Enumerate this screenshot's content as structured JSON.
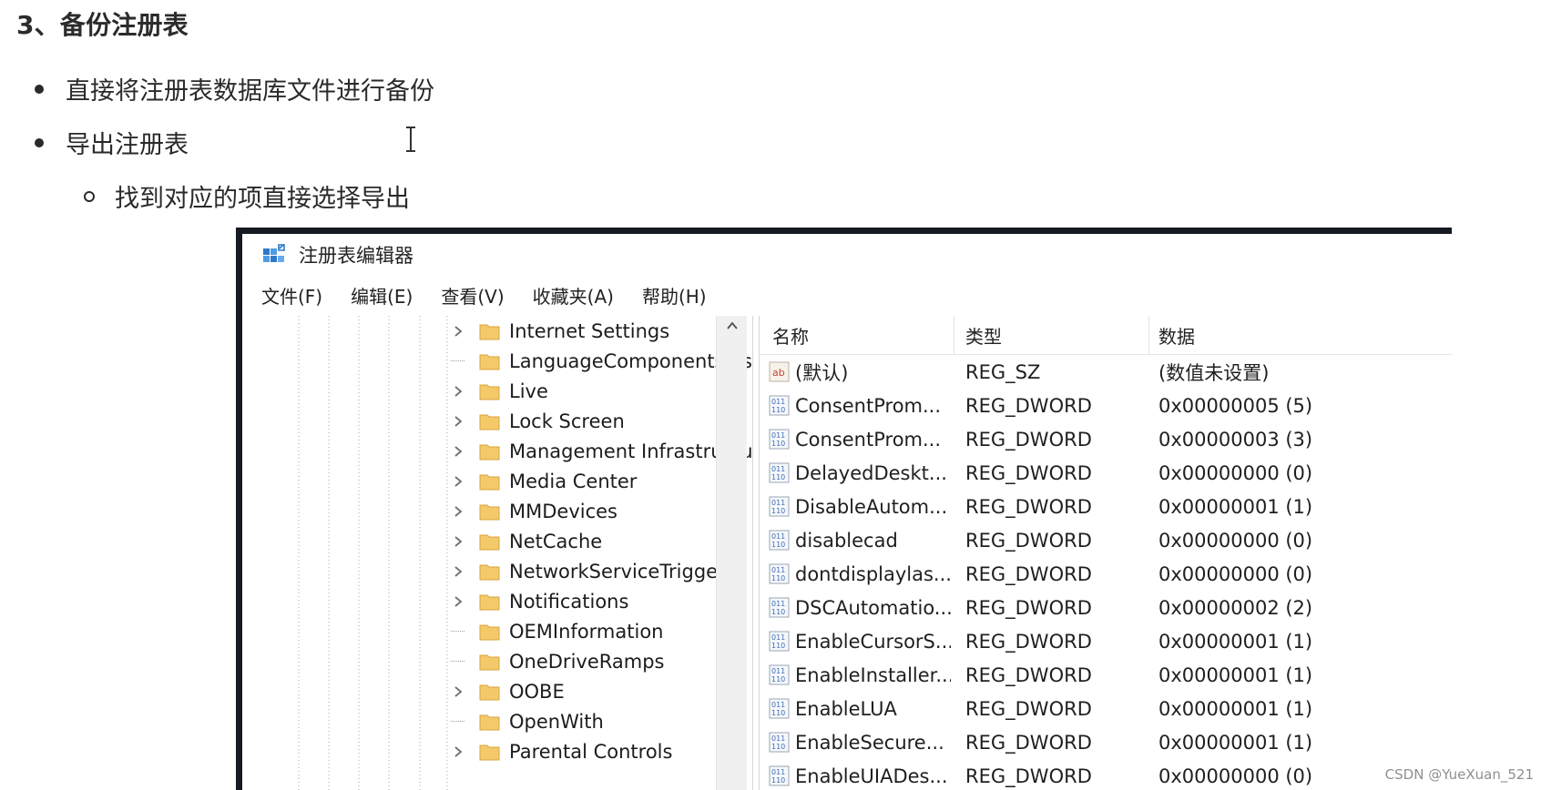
{
  "document": {
    "heading": "3、备份注册表",
    "bullets": [
      "直接将注册表数据库文件进行备份",
      "导出注册表"
    ],
    "subbullets": [
      "找到对应的项直接选择导出"
    ]
  },
  "window": {
    "title": "注册表编辑器",
    "menu": [
      "文件(F)",
      "编辑(E)",
      "查看(V)",
      "收藏夹(A)",
      "帮助(H)"
    ]
  },
  "tree": {
    "items": [
      {
        "label": "Internet Settings",
        "expandable": true
      },
      {
        "label": "LanguageComponentsInst",
        "expandable": false
      },
      {
        "label": "Live",
        "expandable": true
      },
      {
        "label": "Lock Screen",
        "expandable": true
      },
      {
        "label": "Management Infrastructu",
        "expandable": true
      },
      {
        "label": "Media Center",
        "expandable": true
      },
      {
        "label": "MMDevices",
        "expandable": true
      },
      {
        "label": "NetCache",
        "expandable": true
      },
      {
        "label": "NetworkServiceTriggers",
        "expandable": true
      },
      {
        "label": "Notifications",
        "expandable": true
      },
      {
        "label": "OEMInformation",
        "expandable": false
      },
      {
        "label": "OneDriveRamps",
        "expandable": false
      },
      {
        "label": "OOBE",
        "expandable": true
      },
      {
        "label": "OpenWith",
        "expandable": false
      },
      {
        "label": "Parental Controls",
        "expandable": true
      }
    ]
  },
  "values_table": {
    "headers": [
      "名称",
      "类型",
      "数据"
    ],
    "rows": [
      {
        "name": "(默认)",
        "type": "REG_SZ",
        "data": "(数值未设置)",
        "icon": "string-value-icon"
      },
      {
        "name": "ConsentProm...",
        "type": "REG_DWORD",
        "data": "0x00000005 (5)",
        "icon": "dword-value-icon"
      },
      {
        "name": "ConsentProm...",
        "type": "REG_DWORD",
        "data": "0x00000003 (3)",
        "icon": "dword-value-icon"
      },
      {
        "name": "DelayedDeskt...",
        "type": "REG_DWORD",
        "data": "0x00000000 (0)",
        "icon": "dword-value-icon"
      },
      {
        "name": "DisableAutom...",
        "type": "REG_DWORD",
        "data": "0x00000001 (1)",
        "icon": "dword-value-icon"
      },
      {
        "name": "disablecad",
        "type": "REG_DWORD",
        "data": "0x00000000 (0)",
        "icon": "dword-value-icon"
      },
      {
        "name": "dontdisplaylas...",
        "type": "REG_DWORD",
        "data": "0x00000000 (0)",
        "icon": "dword-value-icon"
      },
      {
        "name": "DSCAutomatio...",
        "type": "REG_DWORD",
        "data": "0x00000002 (2)",
        "icon": "dword-value-icon"
      },
      {
        "name": "EnableCursorS...",
        "type": "REG_DWORD",
        "data": "0x00000001 (1)",
        "icon": "dword-value-icon"
      },
      {
        "name": "EnableInstaller...",
        "type": "REG_DWORD",
        "data": "0x00000001 (1)",
        "icon": "dword-value-icon"
      },
      {
        "name": "EnableLUA",
        "type": "REG_DWORD",
        "data": "0x00000001 (1)",
        "icon": "dword-value-icon"
      },
      {
        "name": "EnableSecure...",
        "type": "REG_DWORD",
        "data": "0x00000001 (1)",
        "icon": "dword-value-icon"
      },
      {
        "name": "EnableUIADes...",
        "type": "REG_DWORD",
        "data": "0x00000000 (0)",
        "icon": "dword-value-icon"
      }
    ]
  },
  "watermark": "CSDN @YueXuan_521",
  "colors": {
    "window_frame": "#161a22",
    "folder": "#f4c96a",
    "value_icon_blue": "#3f6fb6",
    "value_icon_red": "#c4473b"
  }
}
